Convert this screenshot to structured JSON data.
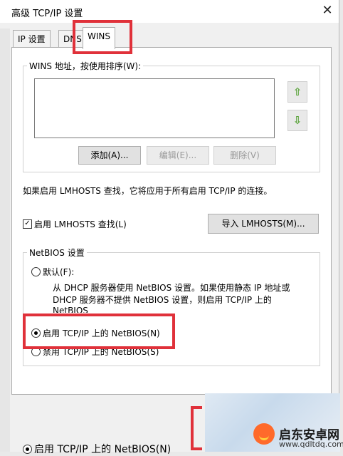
{
  "window": {
    "title": "高级 TCP/IP 设置",
    "close_glyph": "✕"
  },
  "tabs": [
    {
      "label": "IP 设置"
    },
    {
      "label": "DNS"
    },
    {
      "label": "WINS"
    }
  ],
  "wins": {
    "group_label": "WINS 地址，按使用排序(W):",
    "up_icon": "⇧",
    "down_icon": "⇩",
    "add_button": "添加(A)...",
    "edit_button": "编辑(E)...",
    "remove_button": "删除(V)"
  },
  "lmhosts": {
    "note": "如果启用 LMHOSTS 查找，它将应用于所有启用 TCP/IP 的连接。",
    "checkbox_label": "启用 LMHOSTS 查找(L)",
    "checkbox_glyph": "✓",
    "checked": true,
    "import_button": "导入 LMHOSTS(M)..."
  },
  "netbios": {
    "group_label": "NetBIOS 设置",
    "default_label": "默认(F):",
    "default_desc_1": "从 DHCP 服务器使用 NetBIOS 设置。如果使用静态 IP 地址或",
    "default_desc_2": "DHCP 服务器不提供 NetBIOS 设置，则启用 TCP/IP 上的",
    "default_desc_3": "NetBIOS",
    "enable_label": "启用 TCP/IP 上的 NetBIOS(N)",
    "disable_label": "禁用 TCP/IP 上的 NetBIOS(S)",
    "selected": "enable"
  },
  "background": {
    "bottom_text": "启用 TCP/IP 上的 NetBIOS(N)"
  },
  "watermark": {
    "name": "启东安卓网",
    "url": "www.qdltdq.com"
  },
  "highlight_color": "#e0313a"
}
